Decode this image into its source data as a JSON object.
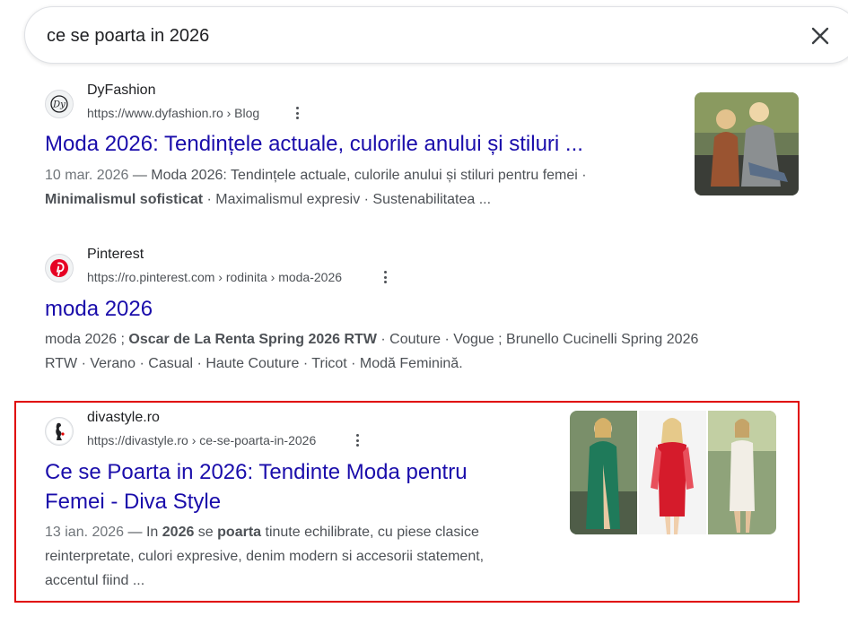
{
  "search": {
    "query": "ce se poarta in 2026"
  },
  "results": [
    {
      "site_name": "DyFashion",
      "url": "https://www.dyfashion.ro › Blog",
      "title": "Moda 2026: Tendințele actuale, culorile anului și stiluri ...",
      "snippet_date": "10 mar. 2026",
      "snippet_sep": " — ",
      "snippet_1": "Moda 2026: Tendințele actuale, culorile anului și stiluri pentru femei ·",
      "snippet_bold_1": "Minimalismul sofisticat",
      "snippet_2": " · Maximalismul expresiv · Sustenabilitatea ..."
    },
    {
      "site_name": "Pinterest",
      "url": "https://ro.pinterest.com › rodinita › moda-2026",
      "title": "moda 2026",
      "snippet_1": "moda 2026 ; ",
      "snippet_bold_1": "Oscar de La Renta Spring 2026 RTW",
      "snippet_2": " · Couture · Vogue ; Brunello Cucinelli Spring 2026",
      "snippet_3": "RTW · Verano · Casual · Haute Couture · Tricot · Modă Feminină."
    },
    {
      "site_name": "divastyle.ro",
      "url": "https://divastyle.ro › ce-se-poarta-in-2026",
      "title_line_1": "Ce se Poarta in 2026: Tendinte Moda pentru",
      "title_line_2": "Femei - Diva Style",
      "snippet_date": "13 ian. 2026",
      "snippet_sep": " — ",
      "snippet_1": "In ",
      "snippet_bold_1": "2026",
      "snippet_2": " se ",
      "snippet_bold_2": "poarta",
      "snippet_3": " tinute echilibrate, cu piese clasice",
      "snippet_4": "reinterpretate, culori expresive, denim modern si accesorii statement,",
      "snippet_5": "accentul fiind ..."
    }
  ],
  "colors": {
    "link": "#1a0dab",
    "snippet": "#4d5156",
    "highlight_border": "#e00000",
    "pinterest_red": "#e60023"
  },
  "icons": {
    "clear": "close-icon",
    "dyfashion": "dyfashion-logo-icon",
    "pinterest": "pinterest-logo-icon",
    "divastyle": "divastyle-logo-icon",
    "more": "more-vert-icon"
  }
}
